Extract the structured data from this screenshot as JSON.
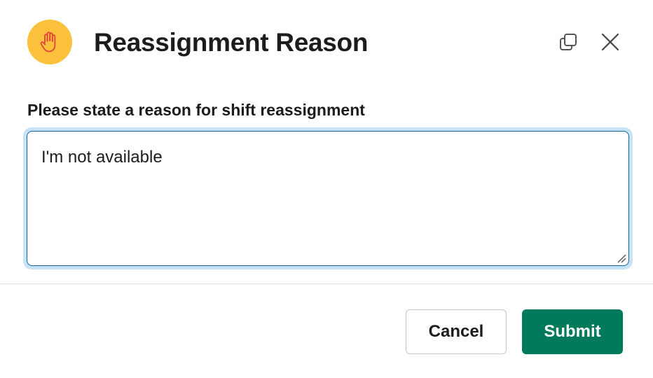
{
  "dialog": {
    "title": "Reassignment Reason",
    "app_icon": "raised-hand-icon",
    "header_actions": [
      "popout-icon",
      "close-icon"
    ]
  },
  "form": {
    "label": "Please state a reason for shift reassignment",
    "reason_value": "I'm not available"
  },
  "footer": {
    "cancel_label": "Cancel",
    "submit_label": "Submit"
  },
  "colors": {
    "icon_bg": "#fcc13c",
    "focus_ring": "#c7e3f7",
    "focus_border": "#1264a3",
    "submit_bg": "#007a5a"
  }
}
